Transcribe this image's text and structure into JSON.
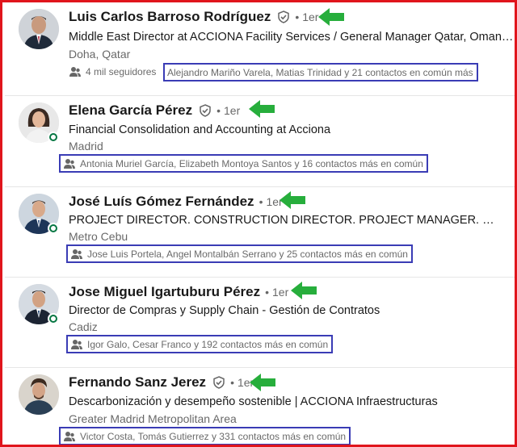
{
  "people": [
    {
      "name": "Luis Carlos Barroso Rodríguez",
      "verified": true,
      "separator": "•",
      "degree": "1er",
      "headline": "Middle East Director at ACCIONA Facility Services / General Manager Qatar, Oman &...",
      "location": "Doha, Qatar",
      "followers": "4 mil seguidores",
      "mutual_names": "Alejandro Mariño Varela, Matias Trinidad",
      "mutual_rest": "y 21 contactos en común más",
      "online": false
    },
    {
      "name": "Elena García Pérez",
      "verified": true,
      "separator": "•",
      "degree": "1er",
      "headline": "Financial Consolidation and Accounting at Acciona",
      "location": "Madrid",
      "mutual_names": "Antonia Muriel García, Elizabeth Montoya Santos",
      "mutual_rest": "y 16 contactos más en común",
      "online": true
    },
    {
      "name": "José Luís Gómez Fernández",
      "verified": false,
      "separator": "•",
      "degree": "1er",
      "headline": "PROJECT DIRECTOR. CONSTRUCTION DIRECTOR. PROJECT MANAGER. Master of...",
      "location": "Metro Cebu",
      "mutual_names": "Jose Luis Portela, Angel Montalbán Serrano",
      "mutual_rest": "y 25 contactos más en común",
      "online": true
    },
    {
      "name": "Jose Miguel Igartuburu Pérez",
      "verified": false,
      "separator": "•",
      "degree": "1er",
      "headline": "Director de Compras y Supply Chain - Gestión de Contratos",
      "location": "Cadiz",
      "mutual_names": "Igor Galo, Cesar Franco",
      "mutual_rest": "y 192 contactos más en común",
      "online": true
    },
    {
      "name": "Fernando Sanz Jerez",
      "verified": true,
      "separator": "•",
      "degree": "1er",
      "headline": "Descarbonización y desempeño sostenible | ACCIONA Infraestructuras",
      "location": "Greater Madrid Metropolitan Area",
      "mutual_names": "Victor Costa, Tomás Gutierrez",
      "mutual_rest": "y 331 contactos más en común",
      "online": false
    }
  ],
  "colors": {
    "frame_border": "#e0151c",
    "highlight_box": "#3a3cb5",
    "arrow": "#27ae3c",
    "online": "#057642"
  },
  "icons": [
    "verified-shield-icon",
    "people-icon",
    "green-arrow-annotation"
  ]
}
